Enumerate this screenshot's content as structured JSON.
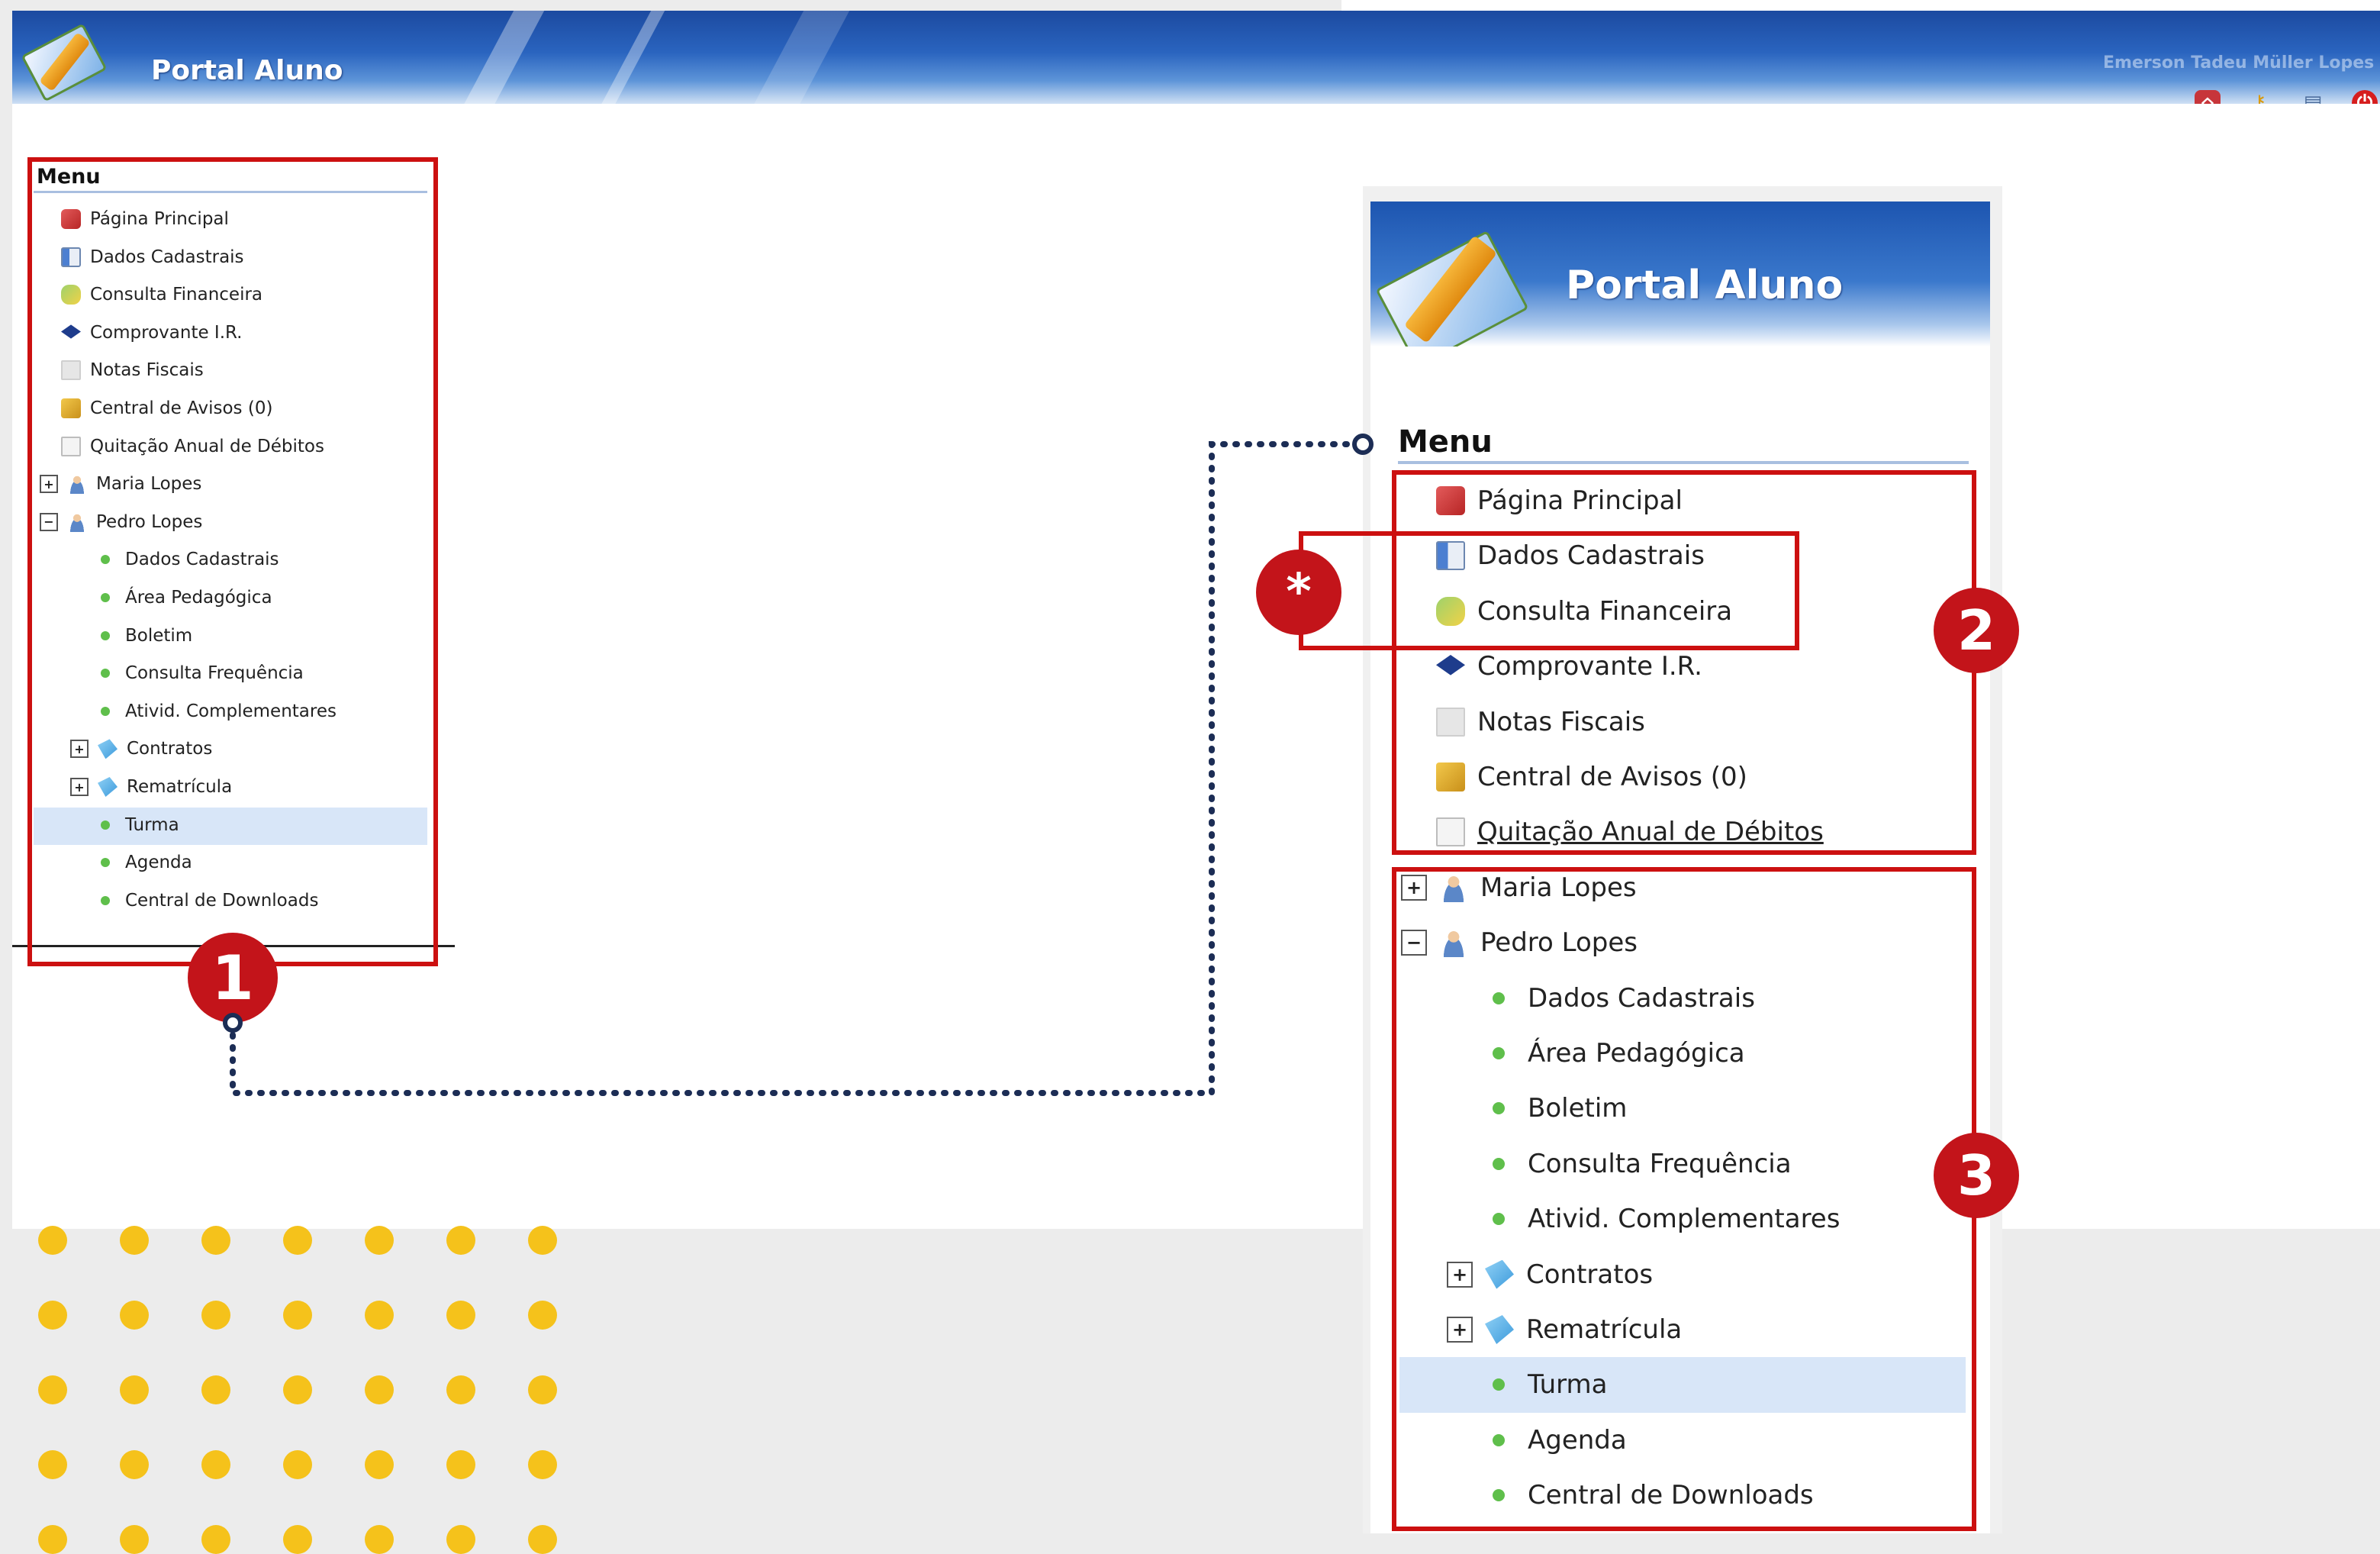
{
  "header": {
    "title": "Portal Aluno",
    "user_name": "Emerson Tadeu Müller Lopes",
    "toolbar_icons": [
      "home-icon",
      "key-icon",
      "windows-icon",
      "power-icon"
    ]
  },
  "menu_left": {
    "title": "Menu",
    "items": [
      {
        "label": "Página Principal",
        "icon": "home-icon"
      },
      {
        "label": "Dados Cadastrais",
        "icon": "id-card-icon"
      },
      {
        "label": "Consulta Financeira",
        "icon": "money-icon"
      },
      {
        "label": "Comprovante I.R.",
        "icon": "tax-icon"
      },
      {
        "label": "Notas Fiscais",
        "icon": "document-icon"
      },
      {
        "label": "Central de Avisos (0)",
        "icon": "megaphone-icon"
      },
      {
        "label": "Quitação Anual de Débitos",
        "icon": "certificate-icon"
      }
    ],
    "students": [
      {
        "name": "Maria Lopes",
        "expanded": false
      },
      {
        "name": "Pedro Lopes",
        "expanded": true
      }
    ],
    "sub_items": [
      {
        "label": "Dados Cadastrais",
        "type": "dot"
      },
      {
        "label": "Área Pedagógica",
        "type": "dot"
      },
      {
        "label": "Boletim",
        "type": "dot"
      },
      {
        "label": "Consulta Frequência",
        "type": "dot"
      },
      {
        "label": "Ativid. Complementares",
        "type": "dot"
      },
      {
        "label": "Contratos",
        "type": "folder"
      },
      {
        "label": "Rematrícula",
        "type": "folder"
      },
      {
        "label": "Turma",
        "type": "dot",
        "selected": true
      },
      {
        "label": "Agenda",
        "type": "dot"
      },
      {
        "label": "Central de Downloads",
        "type": "dot"
      }
    ]
  },
  "zoom_panel": {
    "logo_title": "Portal Aluno",
    "menu_title": "Menu"
  },
  "badges": {
    "one": "1",
    "two": "2",
    "three": "3",
    "asterisk": "*"
  },
  "colors": {
    "highlight_red": "#cc1010",
    "badge_red": "#c3141a",
    "header_blue": "#2a64bf",
    "selected_row": "#d8e6f8",
    "bullet_green": "#5fbf4b",
    "decor_yellow": "#f5c21b",
    "connector_navy": "#1c2d55"
  }
}
